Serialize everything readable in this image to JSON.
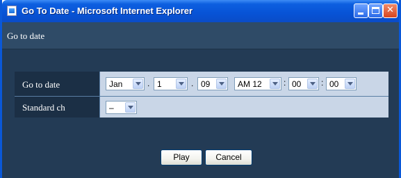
{
  "window": {
    "title": "Go To Date - Microsoft Internet Explorer",
    "icon": "ie-page-icon"
  },
  "header": {
    "title": "Go to date"
  },
  "form": {
    "go_to_date": {
      "label": "Go to date",
      "month": "Jan",
      "day": "1",
      "year": "09",
      "hour": "AM 12",
      "minute": "00",
      "second": "00",
      "date_separator": ".",
      "time_separator": ":"
    },
    "standard_ch": {
      "label": "Standard ch",
      "value": "–"
    }
  },
  "buttons": {
    "play": "Play",
    "cancel": "Cancel"
  },
  "colors": {
    "titlebar": "#0753d6",
    "header_bar": "#2f4b67",
    "content_bg": "#233b55",
    "label_cell": "#1b2f45",
    "value_cell": "#c9d6e7"
  }
}
